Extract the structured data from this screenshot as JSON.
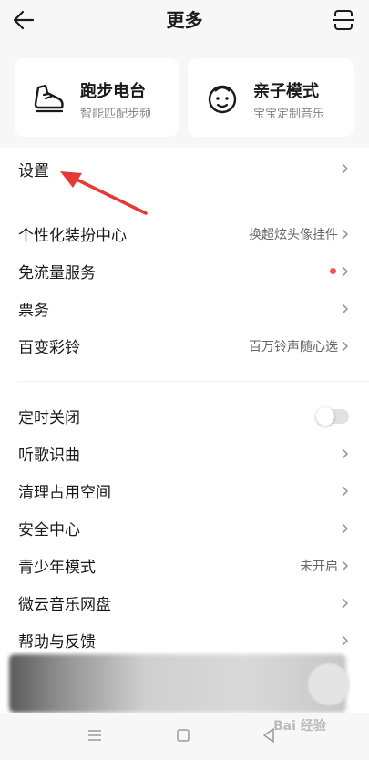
{
  "header": {
    "title": "更多"
  },
  "cards": [
    {
      "title": "跑步电台",
      "subtitle": "智能匹配步频",
      "icon": "running-shoe-icon"
    },
    {
      "title": "亲子模式",
      "subtitle": "宝宝定制音乐",
      "icon": "baby-face-icon"
    }
  ],
  "settings": {
    "label": "设置"
  },
  "group1": [
    {
      "label": "个性化装扮中心",
      "value": "换超炫头像挂件"
    },
    {
      "label": "免流量服务",
      "value": ""
    },
    {
      "label": "票务",
      "value": ""
    },
    {
      "label": "百变彩铃",
      "value": "百万铃声随心选"
    }
  ],
  "group2": [
    {
      "label": "定时关闭",
      "value": ""
    },
    {
      "label": "听歌识曲",
      "value": ""
    },
    {
      "label": "清理占用空间",
      "value": ""
    },
    {
      "label": "安全中心",
      "value": ""
    },
    {
      "label": "青少年模式",
      "value": "未开启"
    },
    {
      "label": "微云音乐网盘",
      "value": ""
    },
    {
      "label": "帮助与反馈",
      "value": ""
    }
  ],
  "timer_toggle": {
    "on": false
  },
  "watermark": "Bai 经验",
  "colors": {
    "accent_dot": "#ff4f5e",
    "arrow": "#e53935"
  }
}
